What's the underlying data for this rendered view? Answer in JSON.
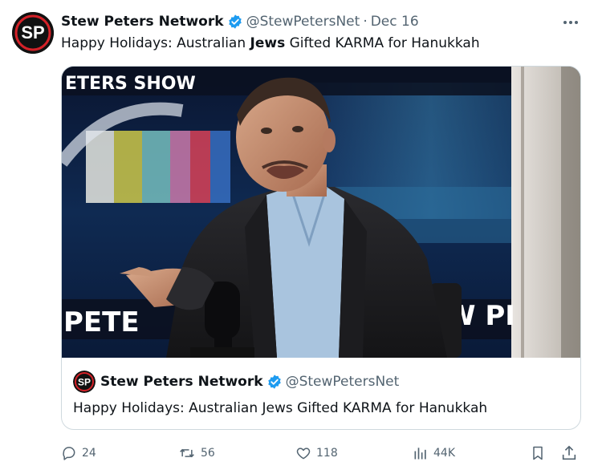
{
  "tweet": {
    "author": {
      "avatar_text": "SP",
      "display_name": "Stew Peters Network",
      "handle": "@StewPetersNet",
      "separator": "·",
      "date": "Dec 16"
    },
    "text_before": "Happy Holidays: Australian ",
    "text_bold": "Jews",
    "text_after": " Gifted KARMA for Hanukkah"
  },
  "quote": {
    "media": {
      "banner_top": "ETERS SHOW",
      "banner_bottom_left": "PETE",
      "banner_bottom_right": "W PI"
    },
    "author": {
      "avatar_text": "SP",
      "display_name": "Stew Peters Network",
      "handle": "@StewPetersNet"
    },
    "text": "Happy Holidays: Australian Jews Gifted KARMA for Hanukkah"
  },
  "actions": {
    "replies": "24",
    "reposts": "56",
    "likes": "118",
    "views": "44K"
  },
  "colors": {
    "muted": "#536471",
    "verified": "#1d9bf0",
    "border": "#cfd9de",
    "logo_red": "#d42128"
  }
}
